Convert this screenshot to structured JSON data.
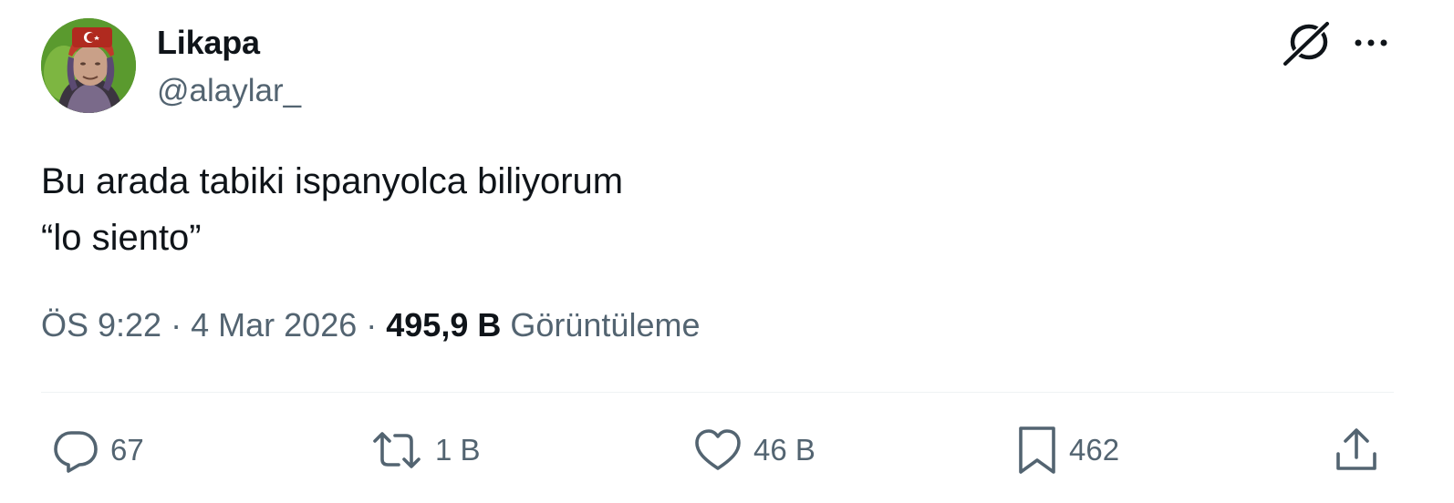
{
  "author": {
    "display_name": "Likapa",
    "handle": "@alaylar_",
    "avatar_icon": "user-avatar"
  },
  "header_icons": {
    "grok": "grok-icon",
    "more": "more-icon"
  },
  "tweet": {
    "lines": [
      "Bu arada tabiki ispanyolca biliyorum",
      "“lo siento”"
    ]
  },
  "meta": {
    "time": "ÖS 9:22",
    "separator": "·",
    "date": "4 Mar 2026",
    "views_count": "495,9 B",
    "views_label": "Görüntüleme"
  },
  "actions": {
    "reply": {
      "icon": "reply-icon",
      "count": "67"
    },
    "retweet": {
      "icon": "retweet-icon",
      "count": "1 B"
    },
    "like": {
      "icon": "heart-icon",
      "count": "46 B"
    },
    "bookmark": {
      "icon": "bookmark-icon",
      "count": "462"
    },
    "share": {
      "icon": "share-icon"
    }
  },
  "colors": {
    "text_primary": "#0f1419",
    "text_secondary": "#536471",
    "divider": "#eff3f4"
  }
}
